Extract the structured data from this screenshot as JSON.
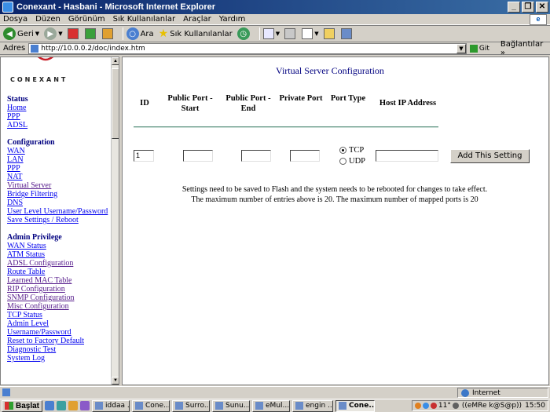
{
  "window": {
    "title": "Conexant - Hasbani - Microsoft Internet Explorer",
    "buttons": [
      "_",
      "❐",
      "✕"
    ]
  },
  "menu": [
    "Dosya",
    "Düzen",
    "Görünüm",
    "Sık Kullanılanlar",
    "Araçlar",
    "Yardım"
  ],
  "toolbar": {
    "back": "Geri",
    "search": "Ara",
    "favorites": "Sık Kullanılanlar"
  },
  "address": {
    "label": "Adres",
    "url": "http://10.0.0.2/doc/index.htm",
    "go": "Git",
    "links": "Bağlantılar"
  },
  "sidebar": {
    "logo": "CONEXANT",
    "sections": [
      {
        "title": "Status",
        "items": [
          "Home",
          "PPP",
          "ADSL"
        ]
      },
      {
        "title": "Configuration",
        "items": [
          "WAN",
          "LAN",
          "PPP",
          "NAT",
          "Virtual Server",
          "Bridge Filtering",
          "DNS",
          "User Level Username/Password",
          "Save Settings / Reboot"
        ]
      },
      {
        "title": "Admin Privilege",
        "items": [
          "WAN Status",
          "ATM Status",
          "ADSL Configuration",
          "Route Table",
          "Learned MAC Table",
          "RIP Configuration",
          "SNMP Configuration",
          "Misc Configuration",
          "TCP Status",
          "Admin Level",
          "Username/Password",
          "Reset to Factory Default",
          "Diagnostic Test",
          "System Log"
        ]
      }
    ]
  },
  "main": {
    "title": "Virtual Server Configuration",
    "columns": {
      "id": "ID",
      "public_start": "Public Port - Start",
      "public_end": "Public Port - End",
      "private": "Private Port",
      "type": "Port Type",
      "host": "Host IP Address"
    },
    "form": {
      "id_value": "1",
      "public_start_value": "",
      "public_end_value": "",
      "private_value": "",
      "host_value": "",
      "tcp_label": "TCP",
      "udp_label": "UDP",
      "selected": "TCP",
      "add_button": "Add This Setting"
    },
    "note1": "Settings need to be saved to Flash and the system needs to be rebooted for changes to take effect.",
    "note2": "The maximum number of entries above is 20. The maximum number of mapped ports is 20"
  },
  "status": {
    "zone": "Internet"
  },
  "taskbar": {
    "start": "Başlat",
    "tasks": [
      "iddaa ...",
      "Cone...",
      "Surro...",
      "Sunu...",
      "eMul...",
      "engin ...",
      "Cone..."
    ],
    "active_index": 6,
    "tray_temp": "11°",
    "tray_user": "((eMRe k@S@p))",
    "clock": "15:50"
  }
}
